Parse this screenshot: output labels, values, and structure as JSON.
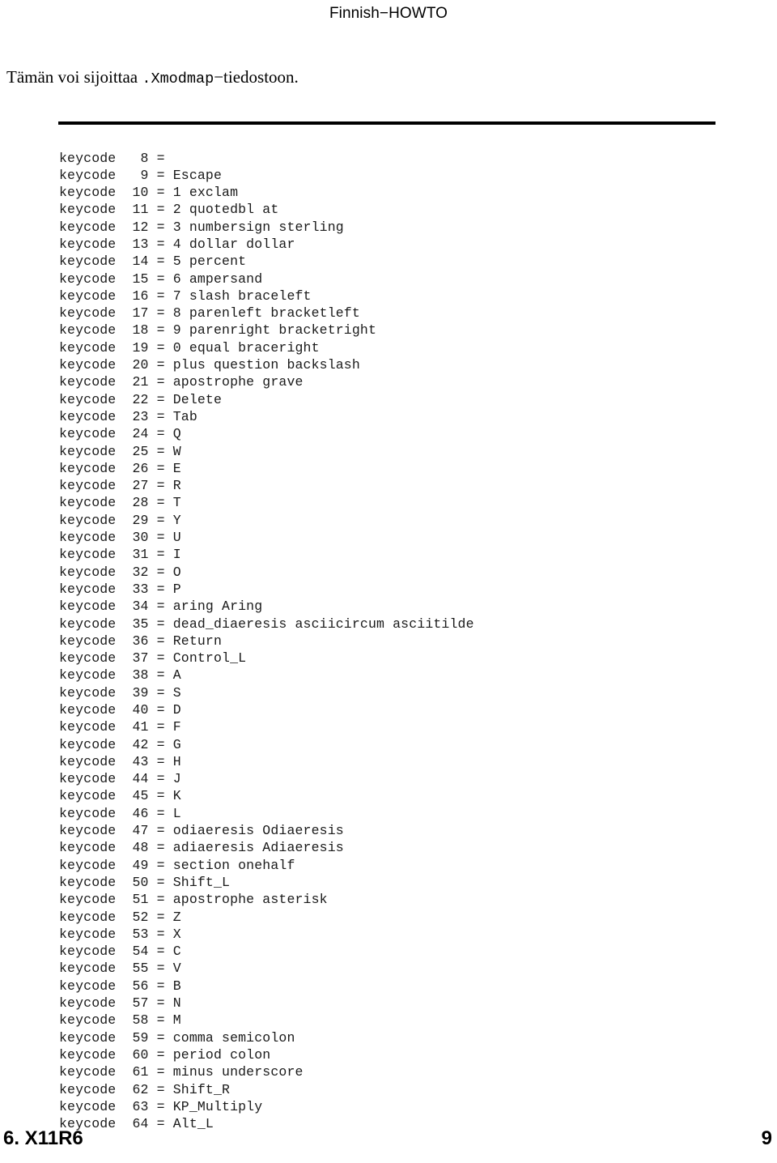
{
  "header": {
    "title": "Finnish−HOWTO"
  },
  "intro": {
    "text_before": "Tämän voi sijoittaa ",
    "mono": ".Xmodmap",
    "text_after": "−tiedostoon."
  },
  "code_block": {
    "lines": [
      "keycode   8 =",
      "keycode   9 = Escape",
      "keycode  10 = 1 exclam",
      "keycode  11 = 2 quotedbl at",
      "keycode  12 = 3 numbersign sterling",
      "keycode  13 = 4 dollar dollar",
      "keycode  14 = 5 percent",
      "keycode  15 = 6 ampersand",
      "keycode  16 = 7 slash braceleft",
      "keycode  17 = 8 parenleft bracketleft",
      "keycode  18 = 9 parenright bracketright",
      "keycode  19 = 0 equal braceright",
      "keycode  20 = plus question backslash",
      "keycode  21 = apostrophe grave",
      "keycode  22 = Delete",
      "keycode  23 = Tab",
      "keycode  24 = Q",
      "keycode  25 = W",
      "keycode  26 = E",
      "keycode  27 = R",
      "keycode  28 = T",
      "keycode  29 = Y",
      "keycode  30 = U",
      "keycode  31 = I",
      "keycode  32 = O",
      "keycode  33 = P",
      "keycode  34 = aring Aring",
      "keycode  35 = dead_diaeresis asciicircum asciitilde",
      "keycode  36 = Return",
      "keycode  37 = Control_L",
      "keycode  38 = A",
      "keycode  39 = S",
      "keycode  40 = D",
      "keycode  41 = F",
      "keycode  42 = G",
      "keycode  43 = H",
      "keycode  44 = J",
      "keycode  45 = K",
      "keycode  46 = L",
      "keycode  47 = odiaeresis Odiaeresis",
      "keycode  48 = adiaeresis Adiaeresis",
      "keycode  49 = section onehalf",
      "keycode  50 = Shift_L",
      "keycode  51 = apostrophe asterisk",
      "keycode  52 = Z",
      "keycode  53 = X",
      "keycode  54 = C",
      "keycode  55 = V",
      "keycode  56 = B",
      "keycode  57 = N",
      "keycode  58 = M",
      "keycode  59 = comma semicolon",
      "keycode  60 = period colon",
      "keycode  61 = minus underscore",
      "keycode  62 = Shift_R",
      "keycode  63 = KP_Multiply",
      "keycode  64 = Alt_L"
    ]
  },
  "footer": {
    "section": "6. X11R6",
    "page_number": "9"
  },
  "colors": {
    "text": "#000000",
    "code_text": "#1a1a1a",
    "rule": "#000000",
    "background": "#ffffff"
  }
}
